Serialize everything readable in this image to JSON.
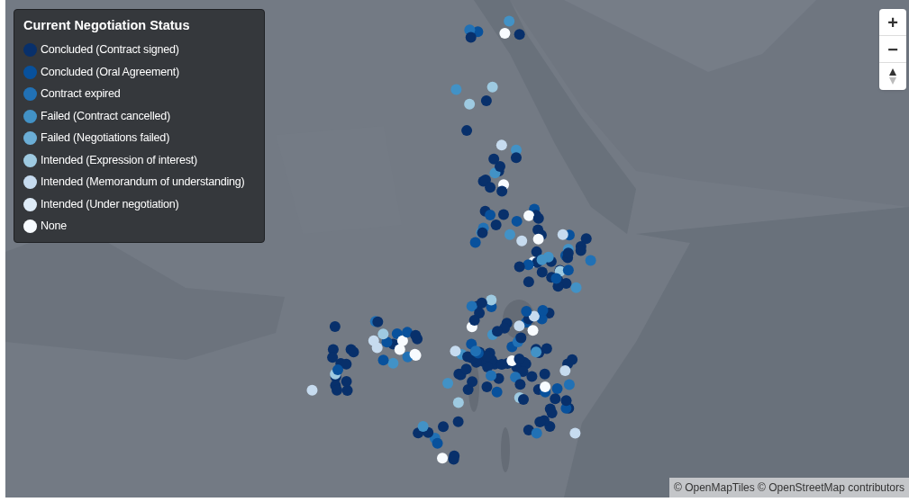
{
  "legend": {
    "title": "Current Negotiation Status",
    "items": [
      {
        "label": "Concluded (Contract signed)",
        "color": "#08306b"
      },
      {
        "label": "Concluded (Oral Agreement)",
        "color": "#08519c"
      },
      {
        "label": "Contract expired",
        "color": "#2171b5"
      },
      {
        "label": "Failed (Contract cancelled)",
        "color": "#4292c6"
      },
      {
        "label": "Failed (Negotiations failed)",
        "color": "#6baed6"
      },
      {
        "label": "Intended (Expression of interest)",
        "color": "#9ecae1"
      },
      {
        "label": "Intended (Memorandum of understanding)",
        "color": "#c6dbef"
      },
      {
        "label": "Intended (Under negotiation)",
        "color": "#deebf7"
      },
      {
        "label": "None",
        "color": "#f7fbff"
      }
    ]
  },
  "zoom_controls": {
    "zoom_in": "+",
    "zoom_out": "−"
  },
  "attribution": "© OpenMapTiles © OpenStreetMap contributors"
}
